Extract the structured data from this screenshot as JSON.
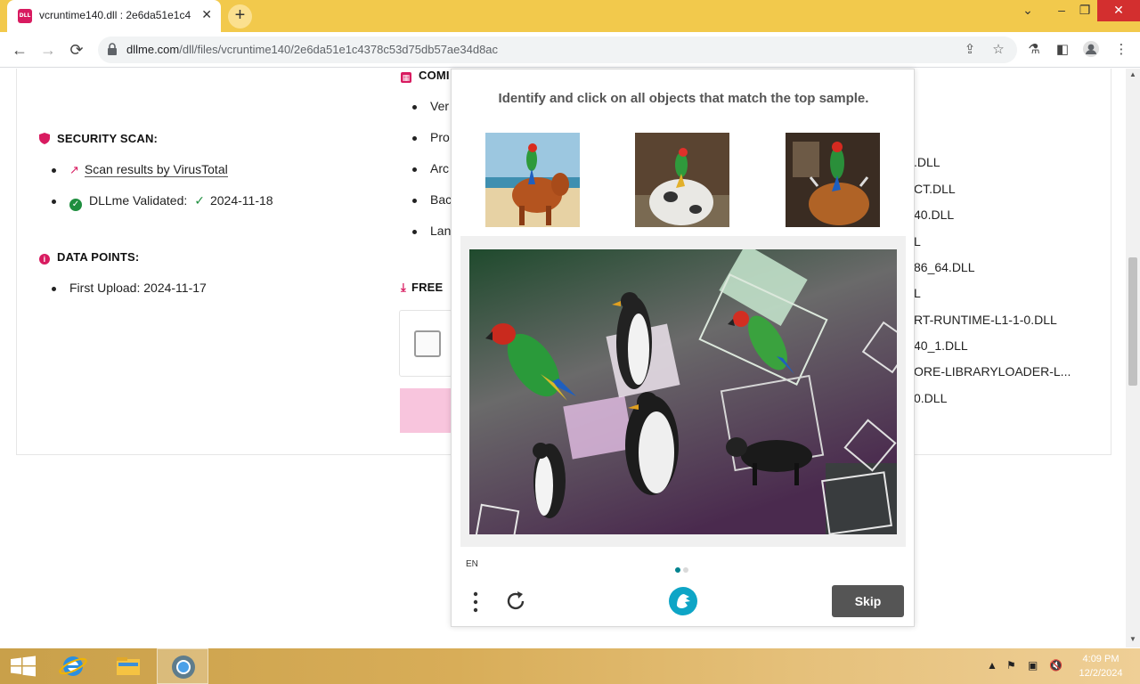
{
  "browser": {
    "tab_title": "vcruntime140.dll : 2e6da51e1c4",
    "favicon_text": "DLL",
    "url_host": "dllme.com",
    "url_path": "/dll/files/vcruntime140/2e6da51e1c4378c53d75db57ae34d8ac"
  },
  "page": {
    "security_scan": {
      "heading": "SECURITY SCAN:",
      "virustotal_link": "Scan results by VirusTotal",
      "validated_label": "DLLme Validated:",
      "validated_date": "2024-11-18"
    },
    "data_points": {
      "heading": "DATA POINTS:",
      "first_upload": "First Upload: 2024-11-17"
    },
    "compat": {
      "heading": "COMI",
      "items": [
        "Ver",
        "Pro",
        "Arc",
        "Bac",
        "Lan"
      ]
    },
    "free": {
      "heading": "FREE"
    },
    "dll_list": [
      ".DLL",
      "CT.DLL",
      "40.DLL",
      "L",
      "86_64.DLL",
      "L",
      "RT-RUNTIME-L1-1-0.DLL",
      "40_1.DLL",
      "ORE-LIBRARYLOADER-L...",
      "0.DLL"
    ]
  },
  "captcha": {
    "prompt": "Identify and click on all objects that match the top sample.",
    "language": "EN",
    "skip_label": "Skip",
    "pages_total": 2,
    "page_current": 1
  },
  "taskbar": {
    "time": "4:09 PM",
    "date": "12/2/2024"
  },
  "colors": {
    "accent": "#d81b60",
    "tabbar": "#f2c94c",
    "skip_button": "#555555",
    "validated_green": "#1e8e3e"
  }
}
